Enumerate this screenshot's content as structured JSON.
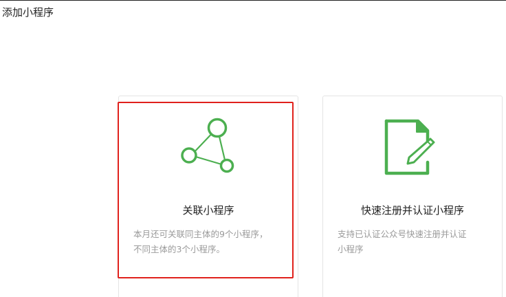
{
  "page": {
    "title": "添加小程序"
  },
  "cards": [
    {
      "icon": "network-nodes-icon",
      "title": "关联小程序",
      "description_line1": "本月还可关联同主体的9个小程序，",
      "description_line2": "不同主体的3个小程序。",
      "selected": true
    },
    {
      "icon": "edit-document-icon",
      "title": "快速注册并认证小程序",
      "description_line1": "支持已认证公众号快速注册并认证",
      "description_line2": "小程序",
      "selected": false
    }
  ],
  "colors": {
    "accent_green": "#4caf50",
    "selection_red": "#e0201b",
    "text_primary": "#222222",
    "text_secondary": "#9a9a9a"
  }
}
